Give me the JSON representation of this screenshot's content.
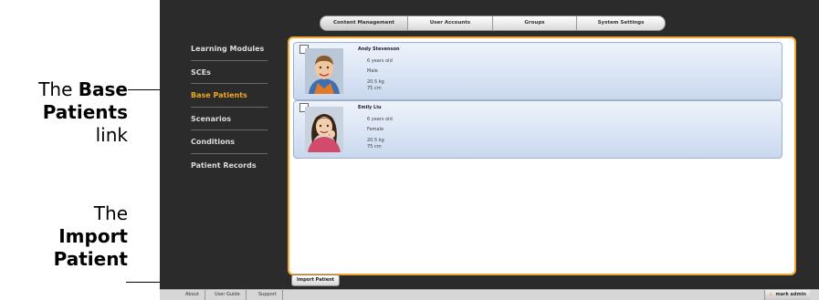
{
  "callouts": {
    "base": {
      "pre": "The ",
      "bold1": "Base",
      "bold2": "Patients",
      "post": "link"
    },
    "import": {
      "pre": "The",
      "bold1": "Import",
      "bold2": "Patient"
    }
  },
  "topnav": {
    "tabs": [
      {
        "label": "Content Management"
      },
      {
        "label": "User Accounts"
      },
      {
        "label": "Groups"
      },
      {
        "label": "System Settings"
      }
    ]
  },
  "sidebar": {
    "items": [
      {
        "label": "Learning Modules"
      },
      {
        "label": "SCEs"
      },
      {
        "label": "Base Patients"
      },
      {
        "label": "Scenarios"
      },
      {
        "label": "Conditions"
      },
      {
        "label": "Patient Records"
      }
    ]
  },
  "patients": [
    {
      "name": "Andy Stevenson",
      "age": "6 years old",
      "sex": "Male",
      "weight": "20.5 kg",
      "height": "75 cm"
    },
    {
      "name": "Emily Liu",
      "age": "6 years old",
      "sex": "Female",
      "weight": "20.5 kg",
      "height": "75 cm"
    }
  ],
  "import_button": {
    "label": "Import Patient"
  },
  "footer": {
    "links": [
      {
        "label": "About"
      },
      {
        "label": "User Guide"
      },
      {
        "label": "Support"
      }
    ],
    "user": "mark admin"
  },
  "colors": {
    "accent": "#f0a535",
    "active_nav": "#f0a820",
    "app_bg": "#2b2b2b"
  }
}
